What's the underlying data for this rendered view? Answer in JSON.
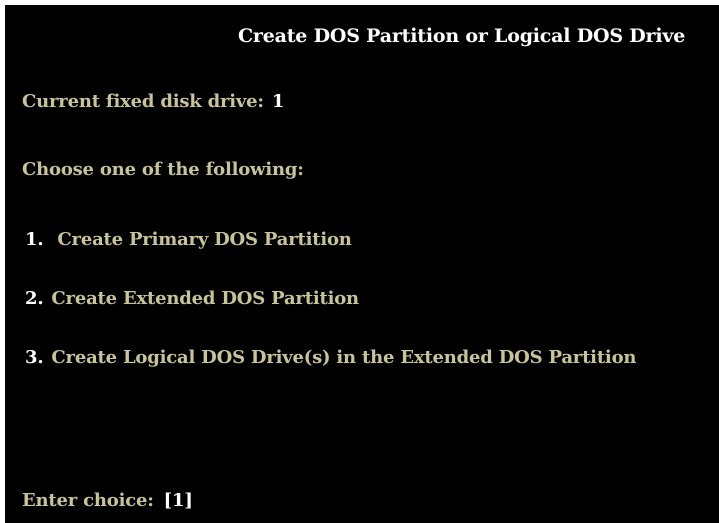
{
  "title": "Create DOS Partition or Logical DOS Drive",
  "current_drive": {
    "label": "Current fixed disk drive:",
    "value": "1"
  },
  "prompt": "Choose one of the following:",
  "options": [
    {
      "number": "1.",
      "label": "Create Primary DOS Partition"
    },
    {
      "number": "2.",
      "label": "Create Extended DOS Partition"
    },
    {
      "number": "3.",
      "label": "Create Logical DOS Drive(s) in the Extended DOS Partition"
    }
  ],
  "enter_choice": {
    "label": "Enter choice:",
    "value": "[1]"
  },
  "colors": {
    "background": "#000000",
    "text_dim": "#c7c39a",
    "text_bright": "#ffffff"
  }
}
